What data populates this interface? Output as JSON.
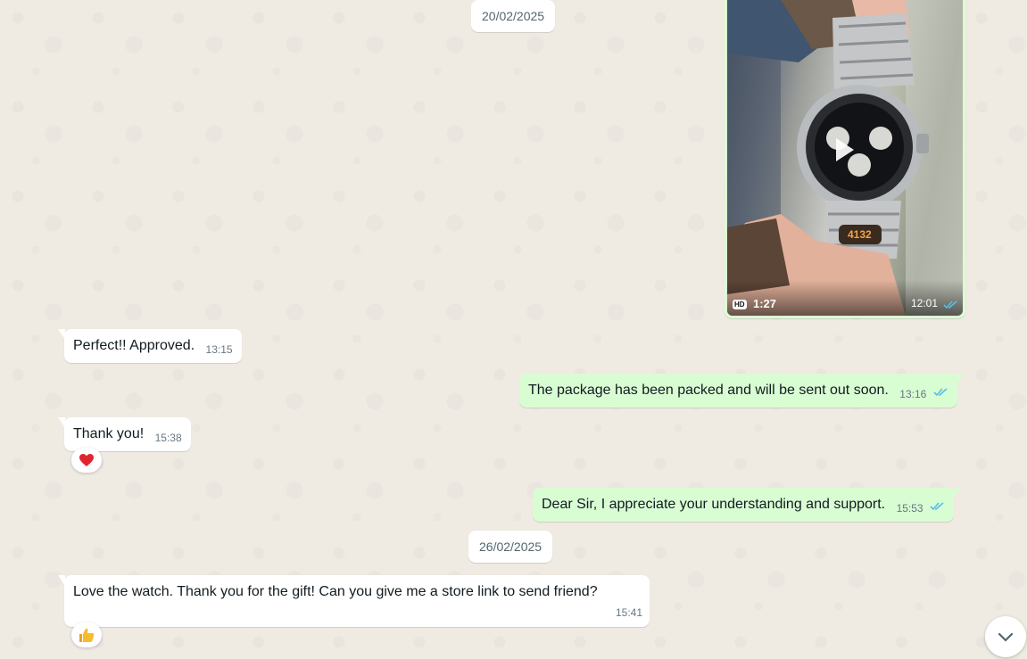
{
  "dates": [
    "20/02/2025",
    "26/02/2025"
  ],
  "video": {
    "quality_badge": "HD",
    "duration": "1:27",
    "time": "12:01",
    "watch_tag": "4132",
    "status": "read"
  },
  "messages": [
    {
      "direction": "incoming",
      "text": "Perfect!!  Approved.",
      "time": "13:15"
    },
    {
      "direction": "outgoing",
      "text": "The package has been packed and will be sent out soon.",
      "time": "13:16",
      "status": "read"
    },
    {
      "direction": "incoming",
      "text": "Thank you!",
      "time": "15:38",
      "reaction": "❤️"
    },
    {
      "direction": "outgoing",
      "text": "Dear Sir, I appreciate your understanding and support.",
      "time": "15:53",
      "status": "read"
    },
    {
      "direction": "incoming",
      "text": "Love the watch.  Thank you for the gift!  Can you give me a store link to send friend?",
      "time": "15:41",
      "reaction": "👍"
    }
  ],
  "icons": {
    "play": "play-icon",
    "read_ticks": "double-check-icon",
    "scroll_down": "chevron-down-icon"
  },
  "colors": {
    "background": "#efeae2",
    "incoming_bubble": "#ffffff",
    "outgoing_bubble": "#d9fdd3",
    "read_ticks": "#53bdeb",
    "meta_text": "#667781"
  }
}
